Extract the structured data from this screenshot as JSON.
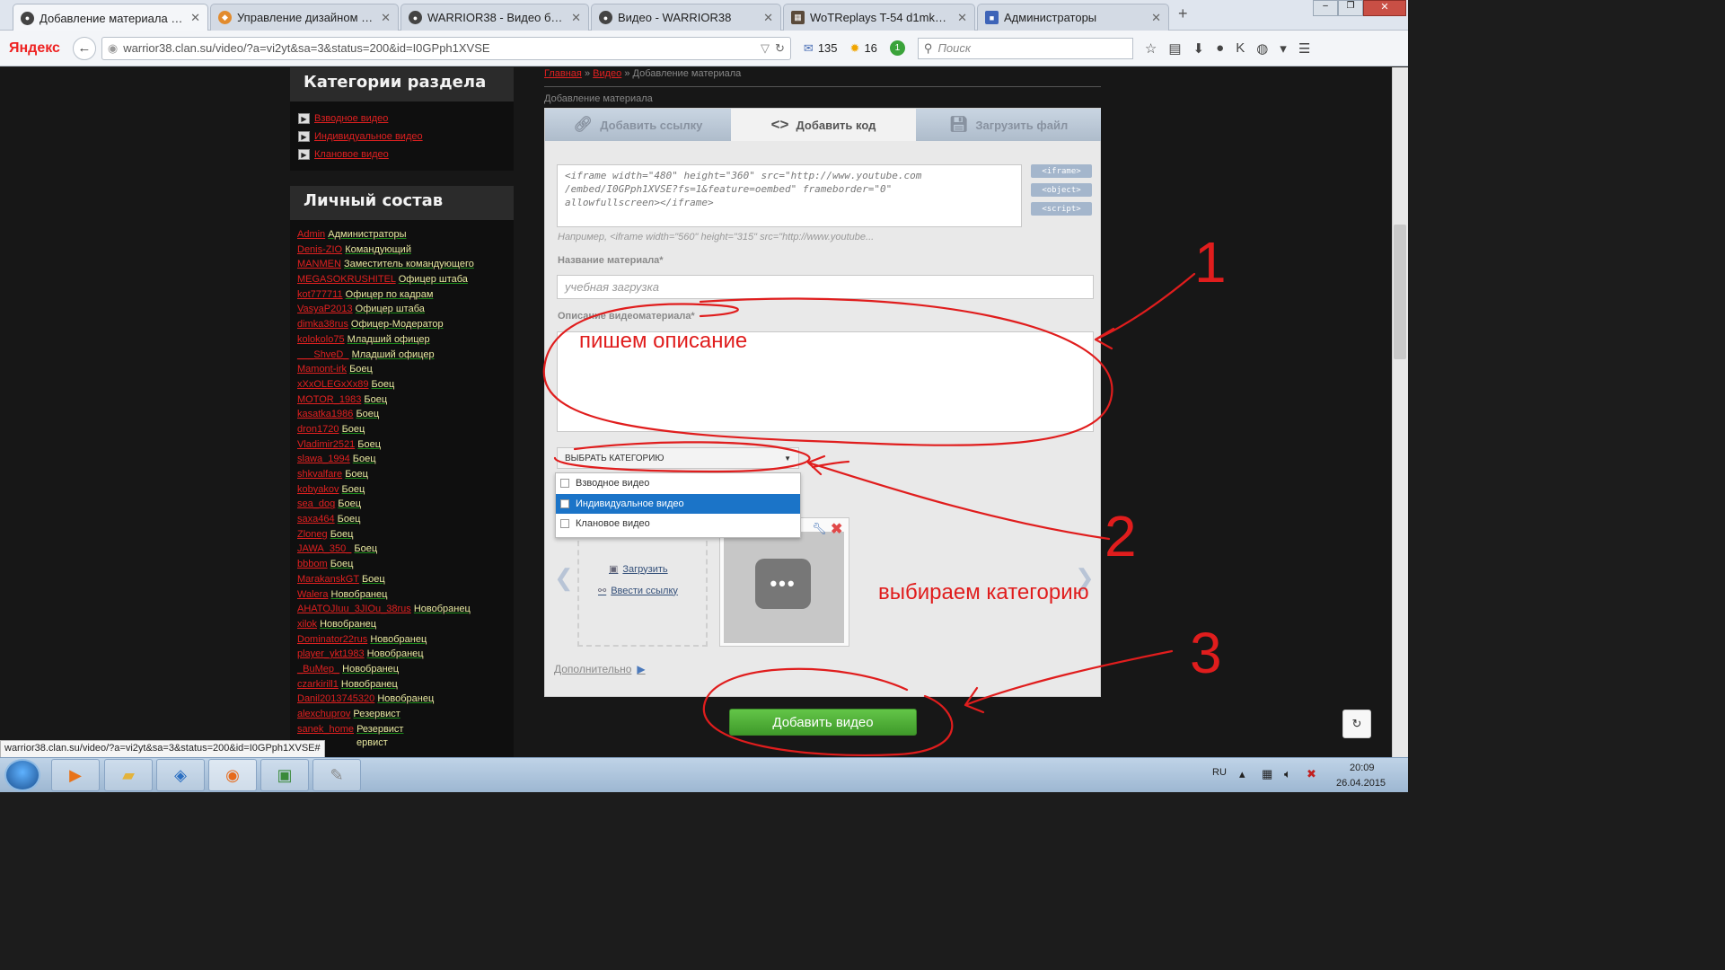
{
  "browser": {
    "tabs": [
      {
        "label": "Добавление материала - ...",
        "icon": "site-favicon"
      },
      {
        "label": "Управление дизайном - ...",
        "icon": "ucoz-favicon"
      },
      {
        "label": "WARRIOR38 - Видео бойц...",
        "icon": "site-favicon"
      },
      {
        "label": "Видео - WARRIOR38",
        "icon": "site-favicon"
      },
      {
        "label": "WoTReplays T-54 d1mka3...",
        "icon": "wotreplays-favicon"
      },
      {
        "label": "Администраторы",
        "icon": "admin-favicon"
      }
    ],
    "new_tab": "+",
    "logo": "Яндекс",
    "url": "warrior38.clan.su/video/?a=vi2yt&sa=3&status=200&id=I0GPph1XVSE",
    "mail_count": "135",
    "weather": "16",
    "notify_count": "1",
    "search_placeholder": "Поиск"
  },
  "sidebar": {
    "categories_title": "Категории раздела",
    "categories": [
      "Взводное видео",
      "Индивидуальное видео",
      "Клановое видео"
    ],
    "staff_title": "Личный состав",
    "members": [
      {
        "name": "Admin",
        "rank": "Администраторы"
      },
      {
        "name": "Denis-ZIO",
        "rank": "Командующий"
      },
      {
        "name": "MANMEN",
        "rank": "Заместитель командующего"
      },
      {
        "name": "MEGASOKRUSHITEL",
        "rank": "Офицер штаба"
      },
      {
        "name": "kot777711",
        "rank": "Офицер по кадрам"
      },
      {
        "name": "VasyaP2013",
        "rank": "Офицер штаба"
      },
      {
        "name": "dimka38rus",
        "rank": "Офицер-Модератор"
      },
      {
        "name": "kolokolo75",
        "rank": "Младший офицер"
      },
      {
        "name": "___ShveD_",
        "rank": "Младший офицер"
      },
      {
        "name": "Mamont-irk",
        "rank": "Боец"
      },
      {
        "name": "xXxOLEGxXx89",
        "rank": "Боец"
      },
      {
        "name": "MOTOR_1983",
        "rank": "Боец"
      },
      {
        "name": "kasatka1986",
        "rank": "Боец"
      },
      {
        "name": "dron1720",
        "rank": "Боец"
      },
      {
        "name": "Vladimir2521",
        "rank": "Боец"
      },
      {
        "name": "slawa_1994",
        "rank": "Боец"
      },
      {
        "name": "shkvalfare",
        "rank": "Боец"
      },
      {
        "name": "kobyakov",
        "rank": "Боец"
      },
      {
        "name": "sea_dog",
        "rank": "Боец"
      },
      {
        "name": "saxa464",
        "rank": "Боец"
      },
      {
        "name": "Zloneg",
        "rank": "Боец"
      },
      {
        "name": "JAWA_350_",
        "rank": "Боец"
      },
      {
        "name": "bbbom",
        "rank": "Боец"
      },
      {
        "name": "MarakanskGT",
        "rank": "Боец"
      },
      {
        "name": "Walera",
        "rank": "Новобранец"
      },
      {
        "name": "AHATOJIuu_3JIOu_38rus",
        "rank": "Новобранец"
      },
      {
        "name": "xilok",
        "rank": "Новобранец"
      },
      {
        "name": "Dominator22rus",
        "rank": "Новобранец"
      },
      {
        "name": "player_ykt1983",
        "rank": "Новобранец"
      },
      {
        "name": "_BuMep_",
        "rank": "Новобранец"
      },
      {
        "name": "czarkirill1",
        "rank": "Новобранец"
      },
      {
        "name": "Danil2013745320",
        "rank": "Новобранец"
      },
      {
        "name": "alexchuprov",
        "rank": "Резервист"
      },
      {
        "name": "sanek_home",
        "rank": "Резервист"
      },
      {
        "name": "",
        "rank": "Резервист"
      }
    ]
  },
  "content": {
    "breadcrumb": {
      "home": "Главная",
      "section": "Видео",
      "current": "» Добавление материала",
      "sep": "»"
    },
    "section_title": "Добавление материала",
    "tabs": [
      {
        "label": "Добавить ссылку",
        "icon": "link-icon"
      },
      {
        "label": "Добавить код",
        "icon": "code-icon"
      },
      {
        "label": "Загрузить файл",
        "icon": "floppy-icon"
      }
    ],
    "code_value": "<iframe width=\"480\" height=\"360\" src=\"http://www.youtube.com\n/embed/I0GPph1XVSE?fs=1&feature=oembed\" frameborder=\"0\"\nallowfullscreen></iframe>",
    "code_tags": [
      "<iframe>",
      "<object>",
      "<script>"
    ],
    "example": "Например, <iframe width=\"560\" height=\"315\" src=\"http://www.youtube...",
    "title_label": "Название материала*",
    "title_value": "учебная загрузка",
    "desc_label": "Описание видеоматериала*",
    "category_select": "ВЫБРАТЬ КАТЕГОРИЮ",
    "category_options": [
      "Взводное видео",
      "Индивидуальное видео",
      "Клановое видео"
    ],
    "upload_link": "Загрузить",
    "url_link": "Ввести ссылку",
    "more_link": "Дополнительно",
    "submit": "Добавить видео"
  },
  "annotations": {
    "n1": "1",
    "n2": "2",
    "n3": "3",
    "desc_hint": "пишем описание",
    "cat_hint": "выбираем категорию",
    "color": "#e01d1d"
  },
  "status_url": "warrior38.clan.su/video/?a=vi2yt&sa=3&status=200&id=I0GPph1XVSE#",
  "status_tail": "ервист",
  "taskbar": {
    "lang": "RU",
    "time": "20:09",
    "date": "26.04.2015"
  }
}
